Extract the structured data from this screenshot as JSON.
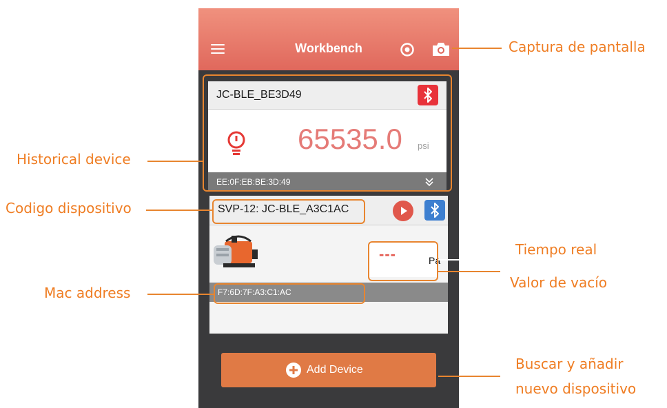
{
  "app": {
    "title": "Workbench",
    "accent": "#e07a45",
    "icons": [
      "menu-icon",
      "record-icon",
      "camera-icon"
    ]
  },
  "devices": [
    {
      "name": "JC-BLE_BE3D49",
      "reading": "65535.0",
      "unit": "psi",
      "mac": "EE:0F:EB:BE:3D:49",
      "bluetooth_color": "#e8323a"
    },
    {
      "name": "SVP-12: JC-BLE_A3C1AC",
      "reading": "---",
      "unit": "Pa",
      "mac": "F7:6D:7F:A3:C1:AC",
      "bluetooth_color": "#3d7fd0"
    }
  ],
  "add_device": {
    "label": "Add Device"
  },
  "annotations": {
    "screenshot": "Captura de pantalla",
    "historical": "Historical device",
    "device_code": "Codigo dispositivo",
    "mac": "Mac address",
    "realtime": "Tiempo real",
    "vacuum": "Valor de vacío",
    "search_1": "Buscar y añadir",
    "search_2": "nuevo dispositivo",
    "color": "#ef7d23"
  }
}
